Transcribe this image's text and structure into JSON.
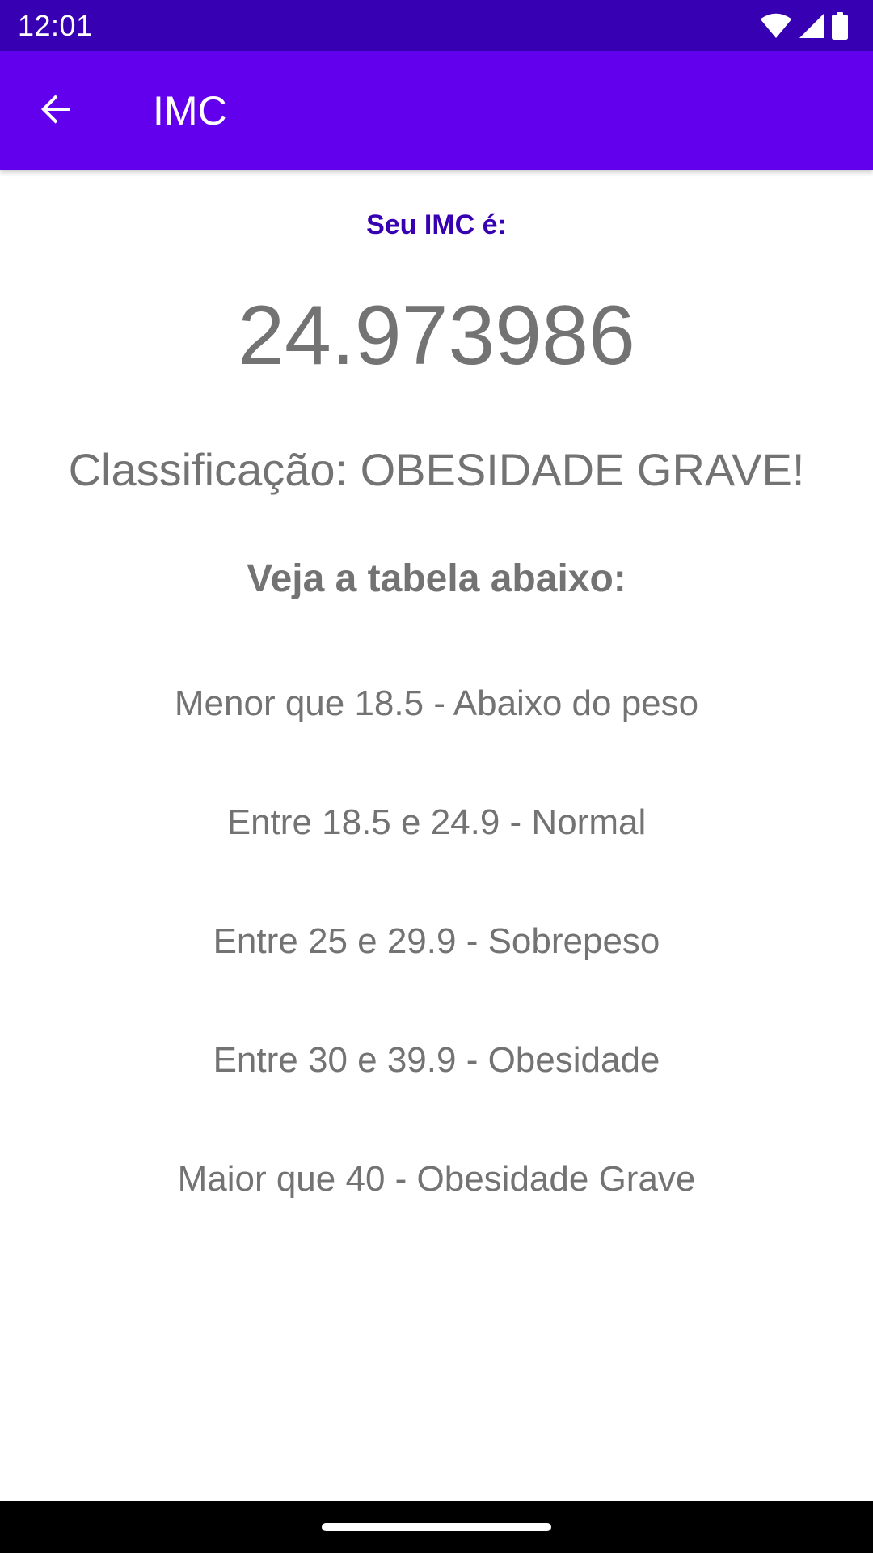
{
  "status_bar": {
    "time": "12:01",
    "icons": [
      "wifi-icon",
      "signal-icon",
      "battery-icon"
    ]
  },
  "app_bar": {
    "title": "IMC",
    "back_icon": "arrow-left-icon"
  },
  "result": {
    "label": "Seu IMC é:",
    "value": "24.973986",
    "classification": "Classificação: OBESIDADE GRAVE!"
  },
  "table": {
    "heading": "Veja a tabela abaixo:",
    "rows": [
      "Menor que 18.5 - Abaixo do peso",
      "Entre 18.5 e 24.9 - Normal",
      "Entre 25 e 29.9 - Sobrepeso",
      "Entre 30 e 39.9 - Obesidade",
      "Maior que 40 - Obesidade Grave"
    ]
  },
  "colors": {
    "status_bar": "#3700b3",
    "app_bar": "#6200ee",
    "label_accent": "#3700b3",
    "body_text": "#737373",
    "background": "#ffffff",
    "nav_bar": "#000000"
  }
}
